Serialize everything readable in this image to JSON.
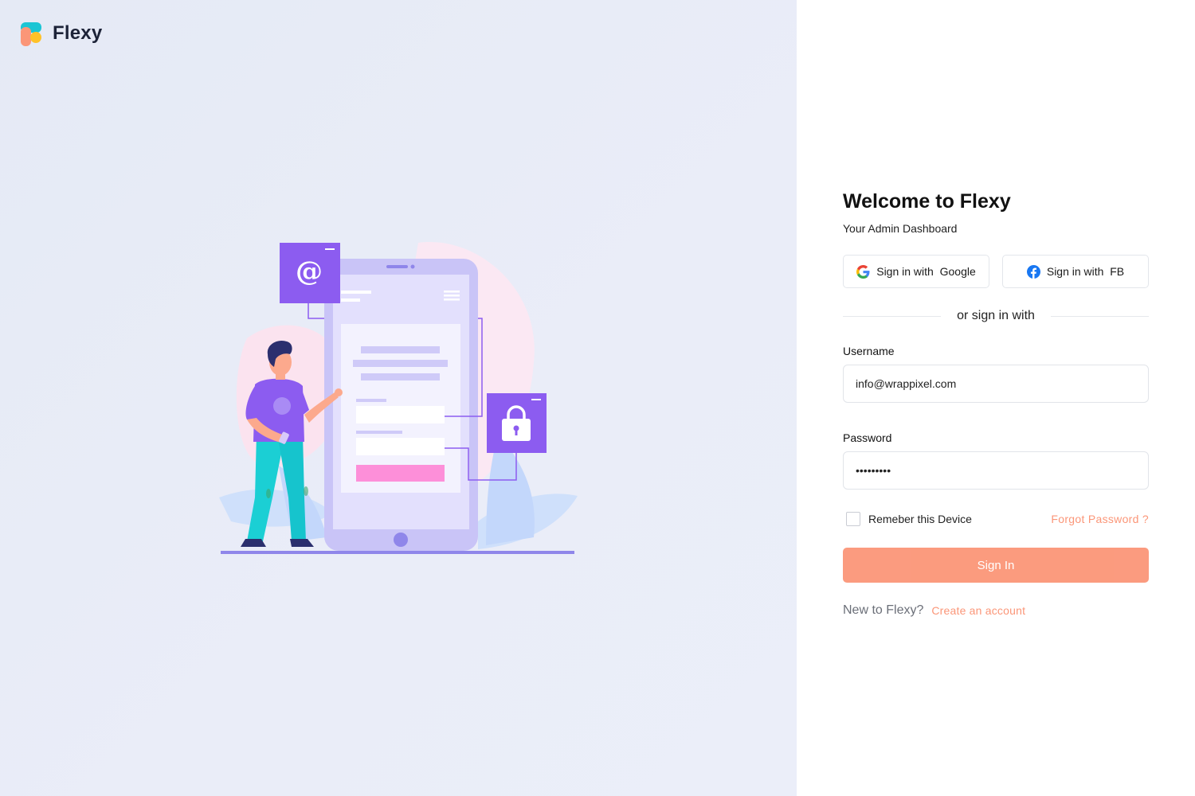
{
  "brand": {
    "name": "Flexy",
    "logo_colors": [
      "#1bc5d4",
      "#fb9678",
      "#ffc228"
    ]
  },
  "login": {
    "title": "Welcome to Flexy",
    "subtitle": "Your Admin Dashboard",
    "google_button": "Sign in with  Google",
    "facebook_button": "Sign in with  FB",
    "divider_text": "or sign in with",
    "username_label": "Username",
    "username_value": "info@wrappixel.com",
    "password_label": "Password",
    "password_value": "•••••••••",
    "remember_label": "Remeber this Device",
    "remember_checked": false,
    "forgot_link": "Forgot Password ?",
    "signin_button": "Sign In",
    "new_text": "New to Flexy?",
    "create_link": "Create an account"
  },
  "colors": {
    "accent": "#fb9678",
    "left_panel_bg": "#e7ebf6",
    "illustration_primary": "#8c5cf0"
  },
  "icons": {
    "google": "google-icon",
    "facebook": "facebook-icon",
    "email": "at-sign-icon",
    "lock": "padlock-icon"
  }
}
